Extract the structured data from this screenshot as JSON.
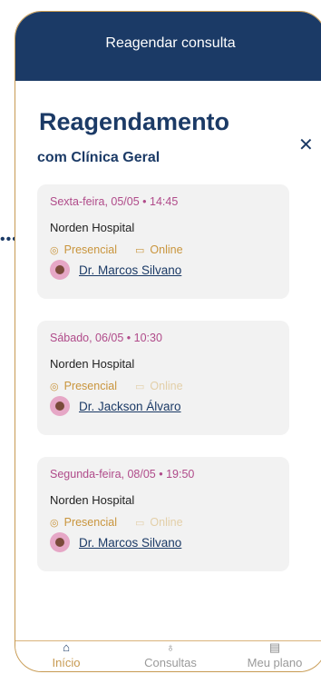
{
  "topbar": {
    "title": "Reagendar consulta"
  },
  "page": {
    "heading": "Reagendamento",
    "subheading": "com Clínica Geral",
    "close_label": "✕",
    "dots": "•••"
  },
  "cards": [
    {
      "date": "Sexta-feira, 05/05 • 14:45",
      "hospital": "Norden Hospital",
      "mode_presencial": "Presencial",
      "mode_online": "Online",
      "online_enabled": true,
      "doctor": "Dr. Marcos Silvano"
    },
    {
      "date": "Sábado, 06/05 • 10:30",
      "hospital": "Norden Hospital",
      "mode_presencial": "Presencial",
      "mode_online": "Online",
      "online_enabled": false,
      "doctor": "Dr. Jackson Álvaro"
    },
    {
      "date": "Segunda-feira, 08/05 • 19:50",
      "hospital": "Norden Hospital",
      "mode_presencial": "Presencial",
      "mode_online": "Online",
      "online_enabled": false,
      "doctor": "Dr. Marcos Silvano"
    }
  ],
  "bottom_nav": {
    "items": [
      {
        "label": "Início",
        "icon": "home-icon"
      },
      {
        "label": "Consultas",
        "icon": "stethoscope-icon"
      },
      {
        "label": "Meu plano",
        "icon": "document-icon"
      }
    ],
    "active_index": 0
  },
  "colors": {
    "primary": "#1b3a66",
    "accent": "#c79a52",
    "date_pink": "#b04b8a",
    "card_bg": "#f2f2f2"
  }
}
